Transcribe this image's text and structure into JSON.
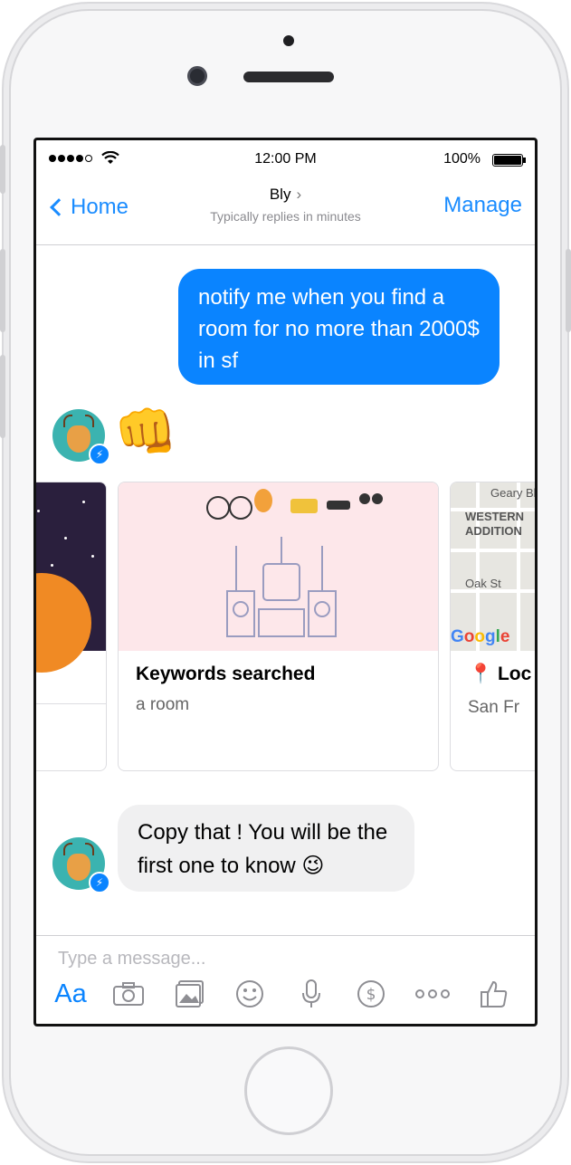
{
  "status_bar": {
    "time": "12:00 PM",
    "battery": "100%"
  },
  "nav": {
    "back_label": "Home",
    "title": "Bly",
    "subtitle": "Typically replies in minutes",
    "manage_label": "Manage"
  },
  "messages": {
    "outgoing_1": "notify me when you find a room for no more than 2000$ in sf",
    "reaction_emoji": "👊",
    "incoming_1": "Copy that ! You will be the first one to know 😉"
  },
  "carousel": {
    "card_2": {
      "title": "Keywords searched",
      "subtitle": "a room"
    },
    "card_3": {
      "map_labels": [
        "Geary Bl",
        "WESTERN",
        "ADDITION",
        "Oak St"
      ],
      "google": "Google",
      "title": "📍 Loc",
      "subtitle": "San Fr"
    }
  },
  "composer": {
    "placeholder": "Type a message...",
    "aa_label": "Aa",
    "icons": [
      "camera-icon",
      "gallery-icon",
      "emoji-icon",
      "microphone-icon",
      "payment-icon",
      "more-icon",
      "like-icon"
    ]
  },
  "colors": {
    "accent": "#0a84ff",
    "outgoing_bubble": "#0a84ff",
    "incoming_bubble": "#f0f0f1"
  }
}
